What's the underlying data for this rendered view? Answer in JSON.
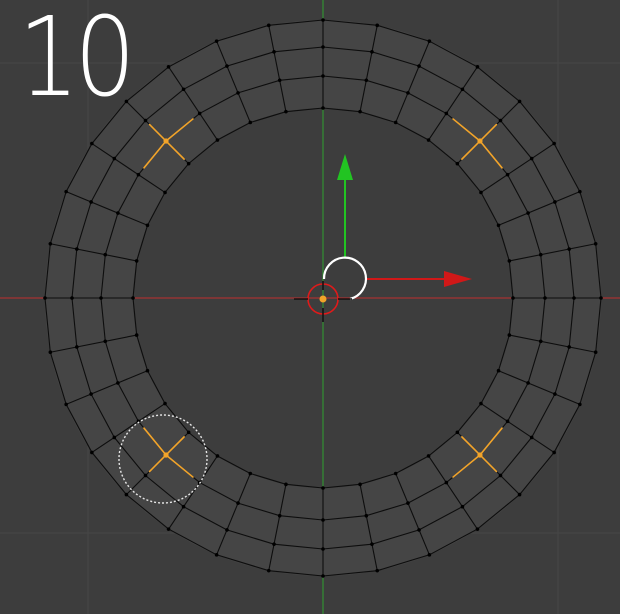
{
  "viewport": {
    "step_label": "10",
    "background_color": "#3d3d3d",
    "grid_color": "#474747",
    "mesh_fill_color": "#454545",
    "edge_color": "#0d0d0d",
    "vertex_color": "#000000",
    "selected_color": "#f2a42a",
    "x_axis_color": "#c02e2e",
    "y_axis_color": "#2fa12f",
    "gizmo_x_color": "#d01818",
    "gizmo_y_color": "#22c422",
    "gizmo_handle_color": "#ffffff",
    "cursor_ring_color": "#e01a1a",
    "brush_ring_color": "#e6e6e6",
    "mesh": {
      "segments": 32,
      "loops": 3
    },
    "icons": {
      "move_gizmo": "move-gizmo-icon",
      "cursor_3d": "crosshair-icon",
      "brush": "circle-select-icon"
    }
  }
}
